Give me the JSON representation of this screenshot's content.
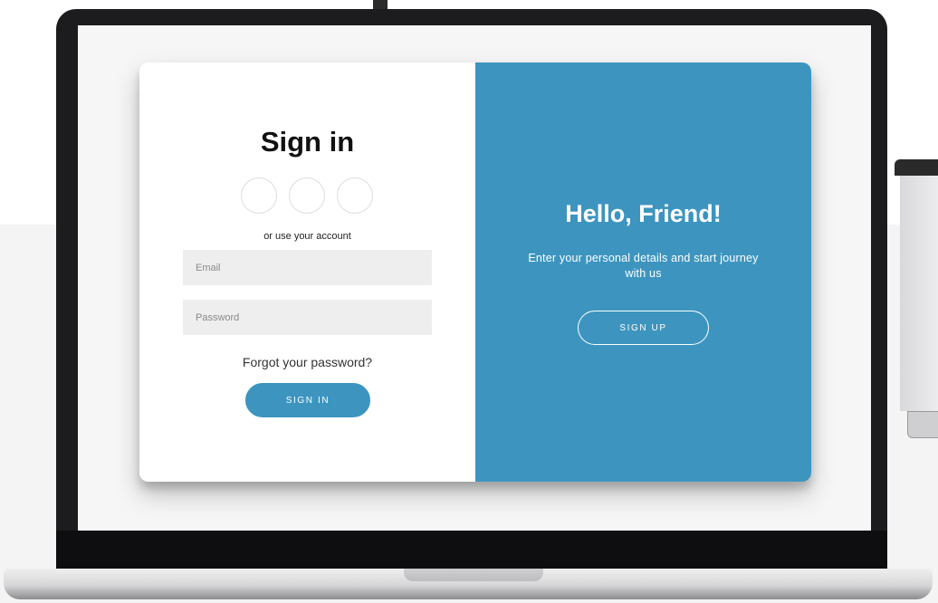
{
  "signin": {
    "title": "Sign in",
    "social_buttons": [
      "social-icon-1",
      "social-icon-2",
      "social-icon-3"
    ],
    "alt_text": "or use your account",
    "email_placeholder": "Email",
    "password_placeholder": "Password",
    "forgot_link": "Forgot your password?",
    "button_label": "SIGN IN"
  },
  "overlay": {
    "title": "Hello, Friend!",
    "text": "Enter your personal details and start journey with us",
    "button_label": "SIGN UP"
  },
  "colors": {
    "accent": "#3d95bf",
    "input_bg": "#eeeeee",
    "laptop_bezel": "#1c1c1e"
  }
}
